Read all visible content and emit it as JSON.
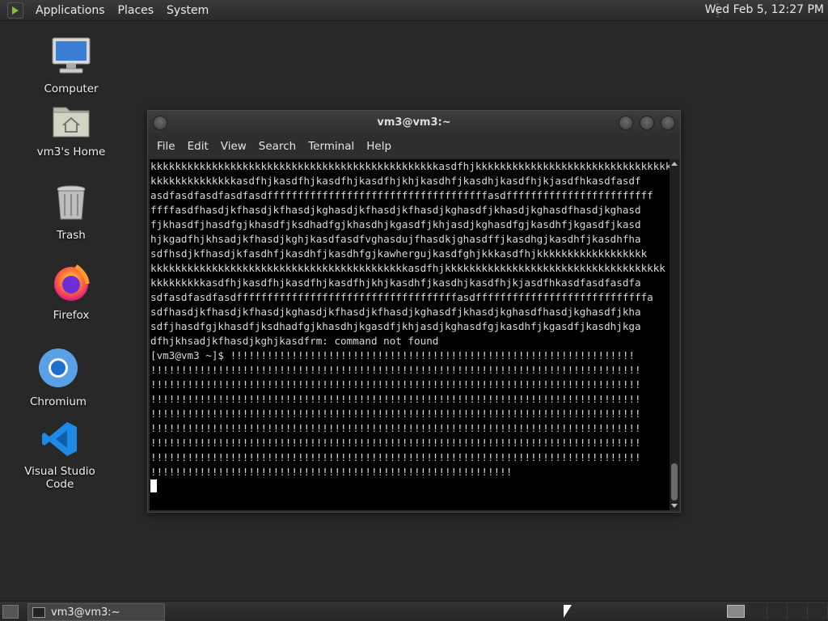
{
  "top_panel": {
    "menus": [
      "Applications",
      "Places",
      "System"
    ],
    "clock": "Wed Feb  5, 12:27 PM"
  },
  "desktop_icons": [
    {
      "label": "Computer",
      "icon": "computer-icon"
    },
    {
      "label": "vm3's Home",
      "icon": "home-folder-icon"
    },
    {
      "label": "Trash",
      "icon": "trash-icon"
    },
    {
      "label": "Firefox",
      "icon": "firefox-icon"
    },
    {
      "label": "Chromium",
      "icon": "chromium-icon"
    },
    {
      "label": "Visual Studio Code",
      "icon": "vscode-icon"
    }
  ],
  "terminal": {
    "title": "vm3@vm3:~",
    "menu": [
      "File",
      "Edit",
      "View",
      "Search",
      "Terminal",
      "Help"
    ],
    "lines": [
      "kkkkkkkkkkkkkkkkkkkkkkkkkkkkkkkkkkkkkkkkkkkkkkkasdfhjkkkkkkkkkkkkkkkkkkkkkkkkkkkkkkkk",
      "kkkkkkkkkkkkkkasdfhjkasdfhjkasdfhjkasdfhjkhjkasdhfjkasdhjkasdfhjkjasdfhkasdfasdf",
      "asdfasdfasdfasdfasdffffffffffffffffffffffffffffffffffffasdffffffffffffffffffffffff",
      "ffffasdfhasdjkfhasdjkfhasdjkghasdjkfhasdjkfhasdjkghasdfjkhasdjkghasdfhasdjkghasd",
      "fjkhasdfjhasdfgjkhasdfjksdhadfgjkhasdhjkgasdfjkhjasdjkghasdfgjkasdhfjkgasdfjkasd",
      "hjkgadfhjkhsadjkfhasdjkghjkasdfasdfvghasdujfhasdkjghasdffjkasdhgjkasdhfjkasdhfha",
      "sdfhsdjkfhasdjkfasdhfjkasdhfjkasdhfgjkawhergujkasdfghjkkkasdfhjkkkkkkkkkkkkkkkkkk",
      "kkkkkkkkkkkkkkkkkkkkkkkkkkkkkkkkkkkkkkkkkkasdfhjkkkkkkkkkkkkkkkkkkkkkkkkkkkkkkkkkkkk",
      "kkkkkkkkkasdfhjkasdfhjkasdfhjkasdfhjkhjkasdhfjkasdhjkasdfhjkjasdfhkasdfasdfasdfa",
      "sdfasdfasdfasdffffffffffffffffffffffffffffffffffffasdffffffffffffffffffffffffffffa",
      "sdfhasdjkfhasdjkfhasdjkghasdjkfhasdjkfhasdjkghasdfjkhasdjkghasdfhasdjkghasdfjkha",
      "sdfjhasdfgjkhasdfjksdhadfgjkhasdhjkgasdfjkhjasdjkghasdfgjkasdhfjkgasdfjkasdhjkga",
      "dfhjkhsadjkfhasdjkghjkasdfrm: command not found",
      "[vm3@vm3 ~]$ !!!!!!!!!!!!!!!!!!!!!!!!!!!!!!!!!!!!!!!!!!!!!!!!!!!!!!!!!!!!!!!!!!",
      "!!!!!!!!!!!!!!!!!!!!!!!!!!!!!!!!!!!!!!!!!!!!!!!!!!!!!!!!!!!!!!!!!!!!!!!!!!!!!!!!",
      "!!!!!!!!!!!!!!!!!!!!!!!!!!!!!!!!!!!!!!!!!!!!!!!!!!!!!!!!!!!!!!!!!!!!!!!!!!!!!!!!",
      "!!!!!!!!!!!!!!!!!!!!!!!!!!!!!!!!!!!!!!!!!!!!!!!!!!!!!!!!!!!!!!!!!!!!!!!!!!!!!!!!",
      "!!!!!!!!!!!!!!!!!!!!!!!!!!!!!!!!!!!!!!!!!!!!!!!!!!!!!!!!!!!!!!!!!!!!!!!!!!!!!!!!",
      "!!!!!!!!!!!!!!!!!!!!!!!!!!!!!!!!!!!!!!!!!!!!!!!!!!!!!!!!!!!!!!!!!!!!!!!!!!!!!!!!",
      "!!!!!!!!!!!!!!!!!!!!!!!!!!!!!!!!!!!!!!!!!!!!!!!!!!!!!!!!!!!!!!!!!!!!!!!!!!!!!!!!",
      "!!!!!!!!!!!!!!!!!!!!!!!!!!!!!!!!!!!!!!!!!!!!!!!!!!!!!!!!!!!!!!!!!!!!!!!!!!!!!!!!",
      "!!!!!!!!!!!!!!!!!!!!!!!!!!!!!!!!!!!!!!!!!!!!!!!!!!!!!!!!!!!"
    ]
  },
  "bottom_panel": {
    "task_label": "vm3@vm3:~"
  }
}
